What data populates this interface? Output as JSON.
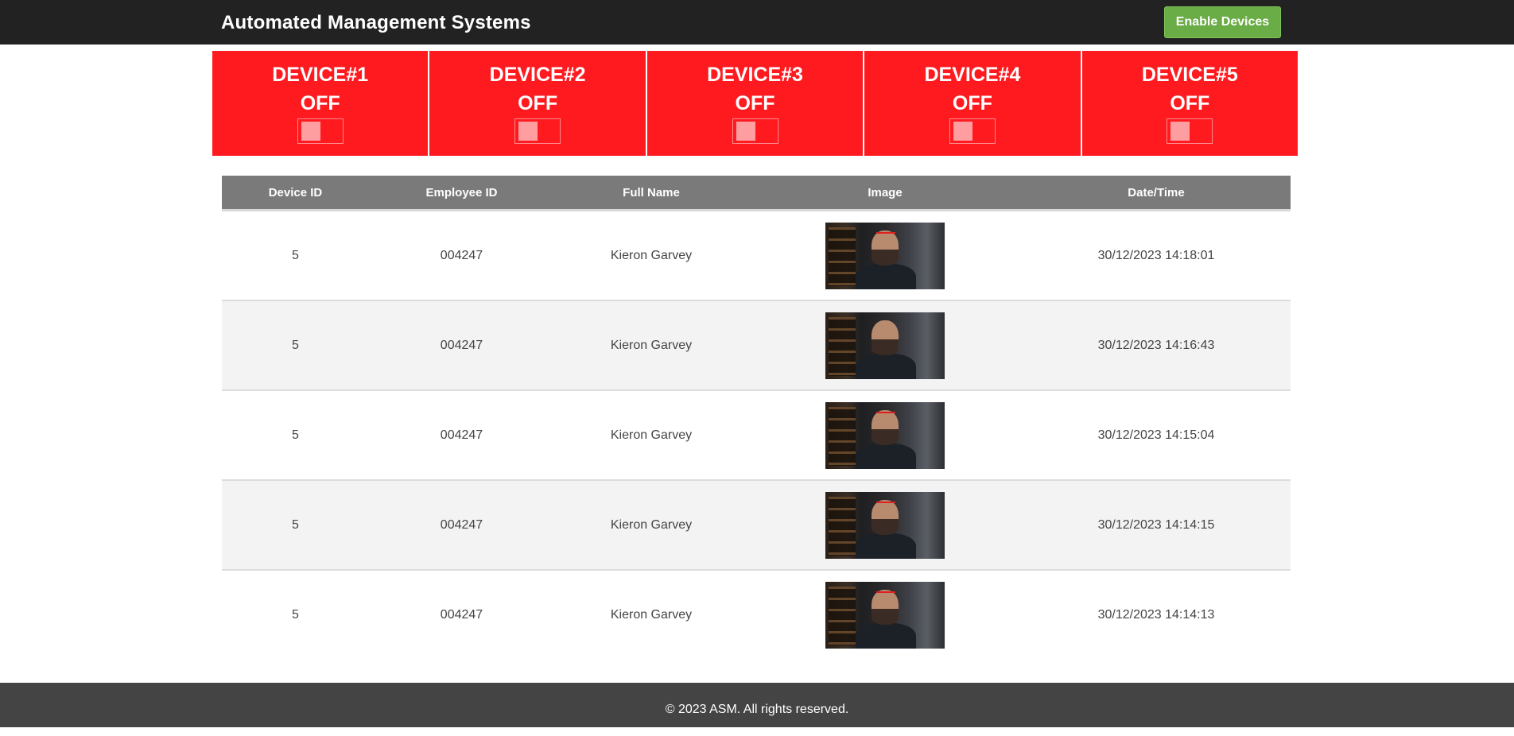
{
  "header": {
    "title": "Automated Management Systems",
    "enable_button_label": "Enable Devices",
    "colors": {
      "bar": "#222222",
      "button": "#6aac45"
    }
  },
  "devices": [
    {
      "name": "DEVICE#1",
      "state": "OFF"
    },
    {
      "name": "DEVICE#2",
      "state": "OFF"
    },
    {
      "name": "DEVICE#3",
      "state": "OFF"
    },
    {
      "name": "DEVICE#4",
      "state": "OFF"
    },
    {
      "name": "DEVICE#5",
      "state": "OFF"
    }
  ],
  "device_panel_color": "#ff1a1f",
  "table": {
    "columns": [
      "Device ID",
      "Employee ID",
      "Full Name",
      "Image",
      "Date/Time"
    ],
    "rows": [
      {
        "device_id": "5",
        "employee_id": "004247",
        "full_name": "Kieron Garvey",
        "image": "employee-photo",
        "datetime": "30/12/2023 14:18:01"
      },
      {
        "device_id": "5",
        "employee_id": "004247",
        "full_name": "Kieron Garvey",
        "image": "employee-photo",
        "datetime": "30/12/2023 14:16:43"
      },
      {
        "device_id": "5",
        "employee_id": "004247",
        "full_name": "Kieron Garvey",
        "image": "employee-photo",
        "datetime": "30/12/2023 14:15:04"
      },
      {
        "device_id": "5",
        "employee_id": "004247",
        "full_name": "Kieron Garvey",
        "image": "employee-photo",
        "datetime": "30/12/2023 14:14:15"
      },
      {
        "device_id": "5",
        "employee_id": "004247",
        "full_name": "Kieron Garvey",
        "image": "employee-photo",
        "datetime": "30/12/2023 14:14:13"
      }
    ]
  },
  "footer": {
    "text": "© 2023 ASM. All rights reserved."
  }
}
